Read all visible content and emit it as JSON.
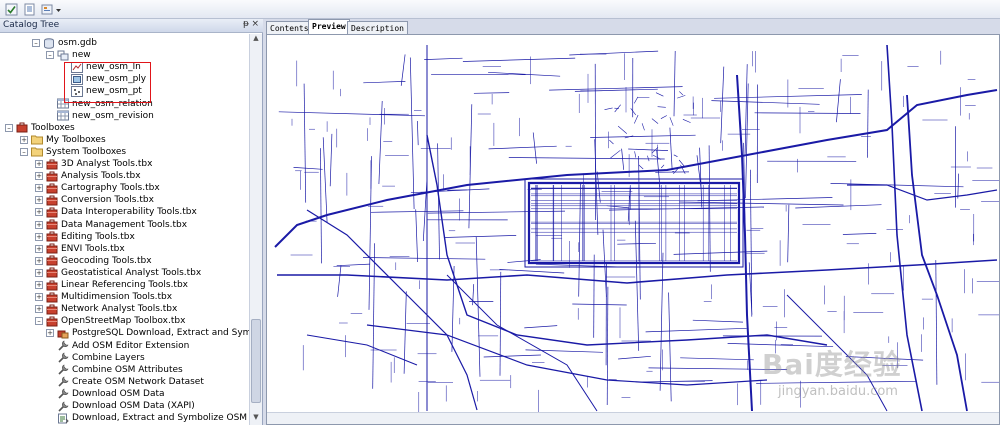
{
  "catalog": {
    "title": "Catalog Tree",
    "pin_glyph": "ᵽ",
    "close_glyph": "×"
  },
  "tree": [
    {
      "label": "osm.gdb",
      "icon": "geodatabase-icon",
      "indent": 0,
      "expander": "-"
    },
    {
      "label": "new",
      "icon": "feature-dataset-icon",
      "indent": 1,
      "expander": "-"
    },
    {
      "label": "new_osm_ln",
      "icon": "line-featureclass-icon",
      "indent": 2,
      "expander": ""
    },
    {
      "label": "new_osm_ply",
      "icon": "polygon-featureclass-icon",
      "indent": 2,
      "expander": ""
    },
    {
      "label": "new_osm_pt",
      "icon": "point-featureclass-icon",
      "indent": 2,
      "expander": ""
    },
    {
      "label": "new_osm_relation",
      "icon": "table-icon",
      "indent": 1,
      "expander": ""
    },
    {
      "label": "new_osm_revision",
      "icon": "table-icon",
      "indent": 1,
      "expander": ""
    },
    {
      "label": "Toolboxes",
      "icon": "toolboxes-icon",
      "indent": -1,
      "expander": "-"
    },
    {
      "label": "My Toolboxes",
      "icon": "folder-icon",
      "indent": 0,
      "expander": "+"
    },
    {
      "label": "System Toolboxes",
      "icon": "folder-icon",
      "indent": 0,
      "expander": "-"
    },
    {
      "label": "3D Analyst Tools.tbx",
      "icon": "toolbox-icon",
      "indent": 1,
      "expander": "+"
    },
    {
      "label": "Analysis Tools.tbx",
      "icon": "toolbox-icon",
      "indent": 1,
      "expander": "+"
    },
    {
      "label": "Cartography Tools.tbx",
      "icon": "toolbox-icon",
      "indent": 1,
      "expander": "+"
    },
    {
      "label": "Conversion Tools.tbx",
      "icon": "toolbox-icon",
      "indent": 1,
      "expander": "+"
    },
    {
      "label": "Data Interoperability Tools.tbx",
      "icon": "toolbox-icon",
      "indent": 1,
      "expander": "+"
    },
    {
      "label": "Data Management Tools.tbx",
      "icon": "toolbox-icon",
      "indent": 1,
      "expander": "+"
    },
    {
      "label": "Editing Tools.tbx",
      "icon": "toolbox-icon",
      "indent": 1,
      "expander": "+"
    },
    {
      "label": "ENVI Tools.tbx",
      "icon": "toolbox-icon",
      "indent": 1,
      "expander": "+"
    },
    {
      "label": "Geocoding Tools.tbx",
      "icon": "toolbox-icon",
      "indent": 1,
      "expander": "+"
    },
    {
      "label": "Geostatistical Analyst Tools.tbx",
      "icon": "toolbox-icon",
      "indent": 1,
      "expander": "+"
    },
    {
      "label": "Linear Referencing Tools.tbx",
      "icon": "toolbox-icon",
      "indent": 1,
      "expander": "+"
    },
    {
      "label": "Multidimension Tools.tbx",
      "icon": "toolbox-icon",
      "indent": 1,
      "expander": "+"
    },
    {
      "label": "Network Analyst Tools.tbx",
      "icon": "toolbox-icon",
      "indent": 1,
      "expander": "+"
    },
    {
      "label": "OpenStreetMap Toolbox.tbx",
      "icon": "toolbox-icon",
      "indent": 1,
      "expander": "-"
    },
    {
      "label": "PostgreSQL Download, Extract and Symbolize",
      "icon": "toolset-icon",
      "indent": 2,
      "expander": "+"
    },
    {
      "label": "Add OSM Editor Extension",
      "icon": "tool-icon",
      "indent": 2,
      "expander": ""
    },
    {
      "label": "Combine Layers",
      "icon": "tool-icon",
      "indent": 2,
      "expander": ""
    },
    {
      "label": "Combine OSM Attributes",
      "icon": "tool-icon",
      "indent": 2,
      "expander": ""
    },
    {
      "label": "Create OSM Network Dataset",
      "icon": "tool-icon",
      "indent": 2,
      "expander": ""
    },
    {
      "label": "Download OSM Data",
      "icon": "tool-icon",
      "indent": 2,
      "expander": ""
    },
    {
      "label": "Download OSM Data (XAPI)",
      "icon": "tool-icon",
      "indent": 2,
      "expander": ""
    },
    {
      "label": "Download, Extract and Symbolize OSM Da",
      "icon": "script-icon",
      "indent": 2,
      "expander": ""
    }
  ],
  "tabs": [
    {
      "label": "Contents",
      "active": false
    },
    {
      "label": "Preview",
      "active": true
    },
    {
      "label": "Description",
      "active": false
    }
  ],
  "watermark": {
    "logo": "Bai度经验",
    "url": "jingyan.baidu.com"
  },
  "colors": {
    "road": "#1a1aa6",
    "highlight": "#e0151a",
    "panel_header": "#cfd8ea"
  }
}
